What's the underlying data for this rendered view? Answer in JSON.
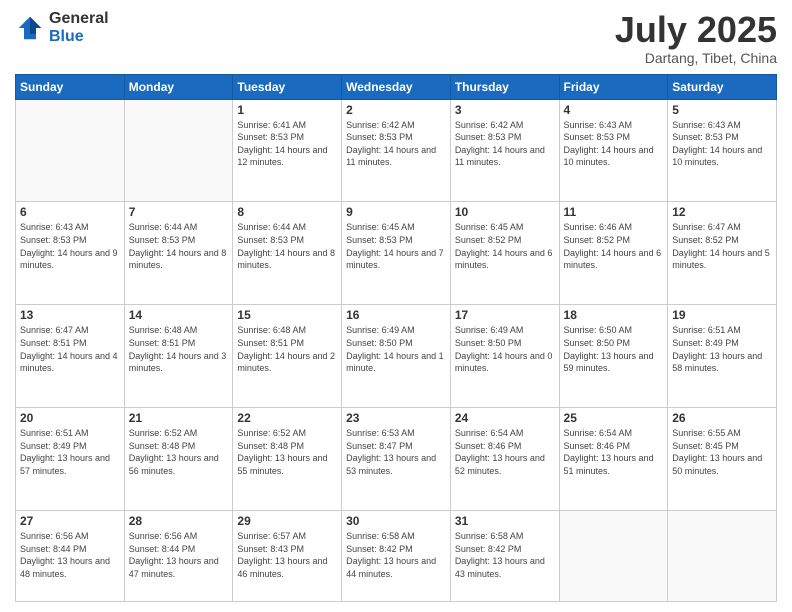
{
  "logo": {
    "general": "General",
    "blue": "Blue"
  },
  "header": {
    "title": "July 2025",
    "subtitle": "Dartang, Tibet, China"
  },
  "weekdays": [
    "Sunday",
    "Monday",
    "Tuesday",
    "Wednesday",
    "Thursday",
    "Friday",
    "Saturday"
  ],
  "weeks": [
    [
      {
        "day": "",
        "info": ""
      },
      {
        "day": "",
        "info": ""
      },
      {
        "day": "1",
        "info": "Sunrise: 6:41 AM\nSunset: 8:53 PM\nDaylight: 14 hours and 12 minutes."
      },
      {
        "day": "2",
        "info": "Sunrise: 6:42 AM\nSunset: 8:53 PM\nDaylight: 14 hours and 11 minutes."
      },
      {
        "day": "3",
        "info": "Sunrise: 6:42 AM\nSunset: 8:53 PM\nDaylight: 14 hours and 11 minutes."
      },
      {
        "day": "4",
        "info": "Sunrise: 6:43 AM\nSunset: 8:53 PM\nDaylight: 14 hours and 10 minutes."
      },
      {
        "day": "5",
        "info": "Sunrise: 6:43 AM\nSunset: 8:53 PM\nDaylight: 14 hours and 10 minutes."
      }
    ],
    [
      {
        "day": "6",
        "info": "Sunrise: 6:43 AM\nSunset: 8:53 PM\nDaylight: 14 hours and 9 minutes."
      },
      {
        "day": "7",
        "info": "Sunrise: 6:44 AM\nSunset: 8:53 PM\nDaylight: 14 hours and 8 minutes."
      },
      {
        "day": "8",
        "info": "Sunrise: 6:44 AM\nSunset: 8:53 PM\nDaylight: 14 hours and 8 minutes."
      },
      {
        "day": "9",
        "info": "Sunrise: 6:45 AM\nSunset: 8:53 PM\nDaylight: 14 hours and 7 minutes."
      },
      {
        "day": "10",
        "info": "Sunrise: 6:45 AM\nSunset: 8:52 PM\nDaylight: 14 hours and 6 minutes."
      },
      {
        "day": "11",
        "info": "Sunrise: 6:46 AM\nSunset: 8:52 PM\nDaylight: 14 hours and 6 minutes."
      },
      {
        "day": "12",
        "info": "Sunrise: 6:47 AM\nSunset: 8:52 PM\nDaylight: 14 hours and 5 minutes."
      }
    ],
    [
      {
        "day": "13",
        "info": "Sunrise: 6:47 AM\nSunset: 8:51 PM\nDaylight: 14 hours and 4 minutes."
      },
      {
        "day": "14",
        "info": "Sunrise: 6:48 AM\nSunset: 8:51 PM\nDaylight: 14 hours and 3 minutes."
      },
      {
        "day": "15",
        "info": "Sunrise: 6:48 AM\nSunset: 8:51 PM\nDaylight: 14 hours and 2 minutes."
      },
      {
        "day": "16",
        "info": "Sunrise: 6:49 AM\nSunset: 8:50 PM\nDaylight: 14 hours and 1 minute."
      },
      {
        "day": "17",
        "info": "Sunrise: 6:49 AM\nSunset: 8:50 PM\nDaylight: 14 hours and 0 minutes."
      },
      {
        "day": "18",
        "info": "Sunrise: 6:50 AM\nSunset: 8:50 PM\nDaylight: 13 hours and 59 minutes."
      },
      {
        "day": "19",
        "info": "Sunrise: 6:51 AM\nSunset: 8:49 PM\nDaylight: 13 hours and 58 minutes."
      }
    ],
    [
      {
        "day": "20",
        "info": "Sunrise: 6:51 AM\nSunset: 8:49 PM\nDaylight: 13 hours and 57 minutes."
      },
      {
        "day": "21",
        "info": "Sunrise: 6:52 AM\nSunset: 8:48 PM\nDaylight: 13 hours and 56 minutes."
      },
      {
        "day": "22",
        "info": "Sunrise: 6:52 AM\nSunset: 8:48 PM\nDaylight: 13 hours and 55 minutes."
      },
      {
        "day": "23",
        "info": "Sunrise: 6:53 AM\nSunset: 8:47 PM\nDaylight: 13 hours and 53 minutes."
      },
      {
        "day": "24",
        "info": "Sunrise: 6:54 AM\nSunset: 8:46 PM\nDaylight: 13 hours and 52 minutes."
      },
      {
        "day": "25",
        "info": "Sunrise: 6:54 AM\nSunset: 8:46 PM\nDaylight: 13 hours and 51 minutes."
      },
      {
        "day": "26",
        "info": "Sunrise: 6:55 AM\nSunset: 8:45 PM\nDaylight: 13 hours and 50 minutes."
      }
    ],
    [
      {
        "day": "27",
        "info": "Sunrise: 6:56 AM\nSunset: 8:44 PM\nDaylight: 13 hours and 48 minutes."
      },
      {
        "day": "28",
        "info": "Sunrise: 6:56 AM\nSunset: 8:44 PM\nDaylight: 13 hours and 47 minutes."
      },
      {
        "day": "29",
        "info": "Sunrise: 6:57 AM\nSunset: 8:43 PM\nDaylight: 13 hours and 46 minutes."
      },
      {
        "day": "30",
        "info": "Sunrise: 6:58 AM\nSunset: 8:42 PM\nDaylight: 13 hours and 44 minutes."
      },
      {
        "day": "31",
        "info": "Sunrise: 6:58 AM\nSunset: 8:42 PM\nDaylight: 13 hours and 43 minutes."
      },
      {
        "day": "",
        "info": ""
      },
      {
        "day": "",
        "info": ""
      }
    ]
  ]
}
